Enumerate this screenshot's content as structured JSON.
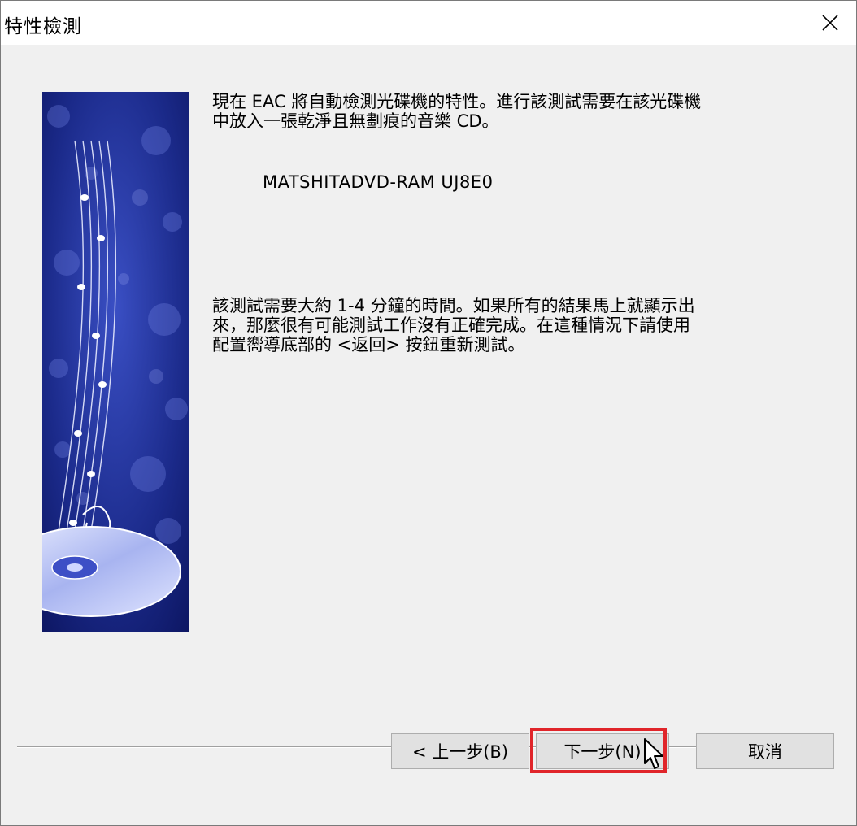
{
  "window": {
    "title": "特性檢測"
  },
  "content": {
    "intro_text": "現在 EAC 將自動檢測光碟機的特性。進行該測試需要在該光碟機\n中放入一張乾淨且無劃痕的音樂 CD。",
    "device_name": "MATSHITADVD-RAM UJ8E0",
    "note_text": "該測試需要大約 1-4 分鐘的時間。如果所有的結果馬上就顯示出\n來，那麼很有可能測試工作沒有正確完成。在這種情況下請使用\n配置嚮導底部的 <返回> 按鈕重新測試。"
  },
  "buttons": {
    "back_label": "< 上一步(B)",
    "next_label": "下一步(N)",
    "cancel_label": "取消"
  },
  "colors": {
    "highlight": "#e0252a",
    "image_base": "#1b2a8a"
  },
  "icons": {
    "close": "close-icon",
    "cursor": "mouse-pointer-icon"
  }
}
